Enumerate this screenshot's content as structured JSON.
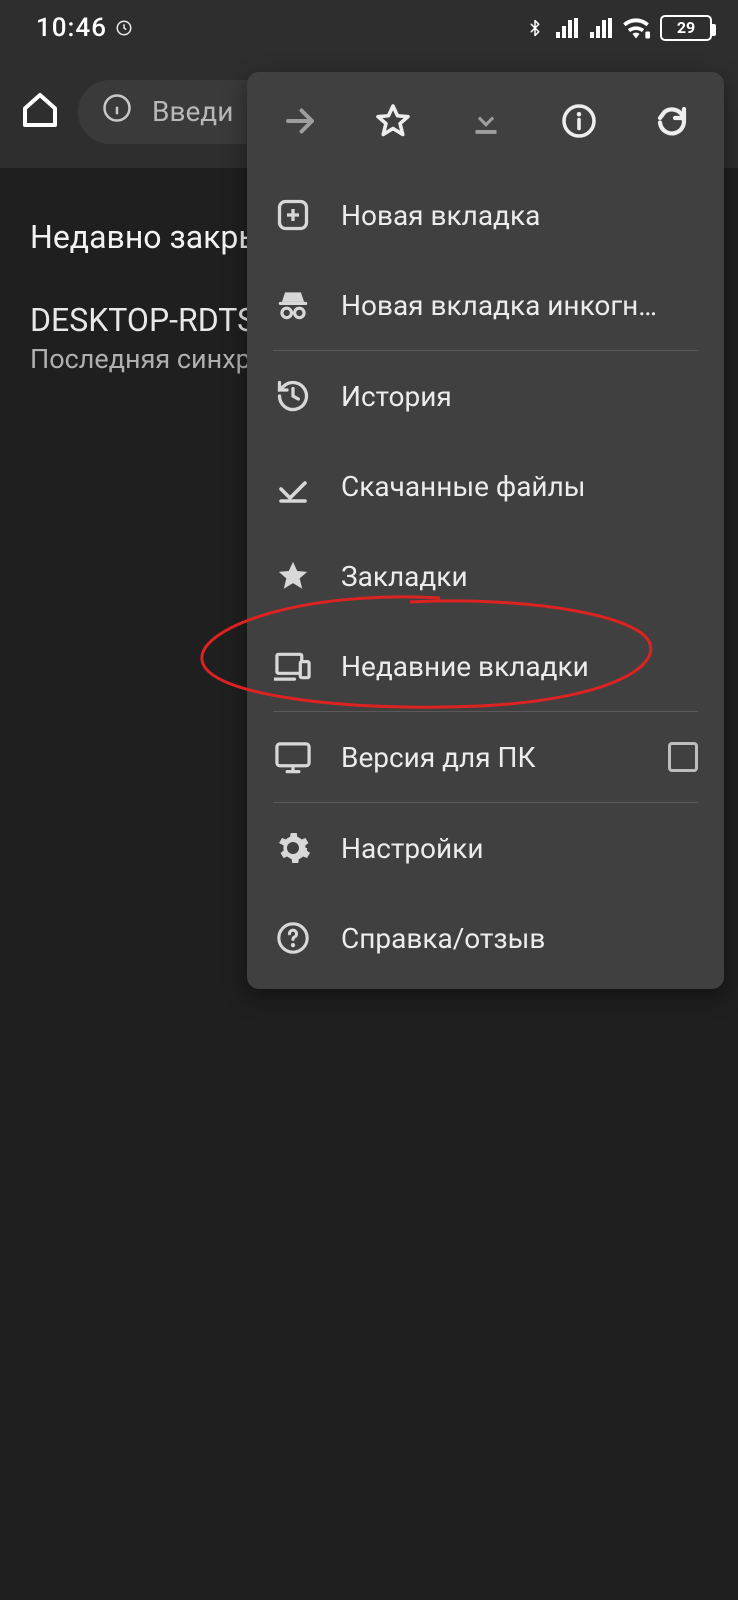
{
  "statusbar": {
    "time": "10:46",
    "battery": "29"
  },
  "navbar": {
    "omnibox_placeholder": "Введи"
  },
  "page": {
    "recently_closed": "Недавно закры",
    "device_name": "DESKTOP-RDTS",
    "last_sync": "Последняя синхр"
  },
  "menu": {
    "new_tab": "Новая вкладка",
    "new_incognito": "Новая вкладка инкогн…",
    "history": "История",
    "downloads": "Скачанные файлы",
    "bookmarks": "Закладки",
    "recent_tabs": "Недавние вкладки",
    "desktop_site": "Версия для ПК",
    "settings": "Настройки",
    "help": "Справка/отзыв"
  }
}
